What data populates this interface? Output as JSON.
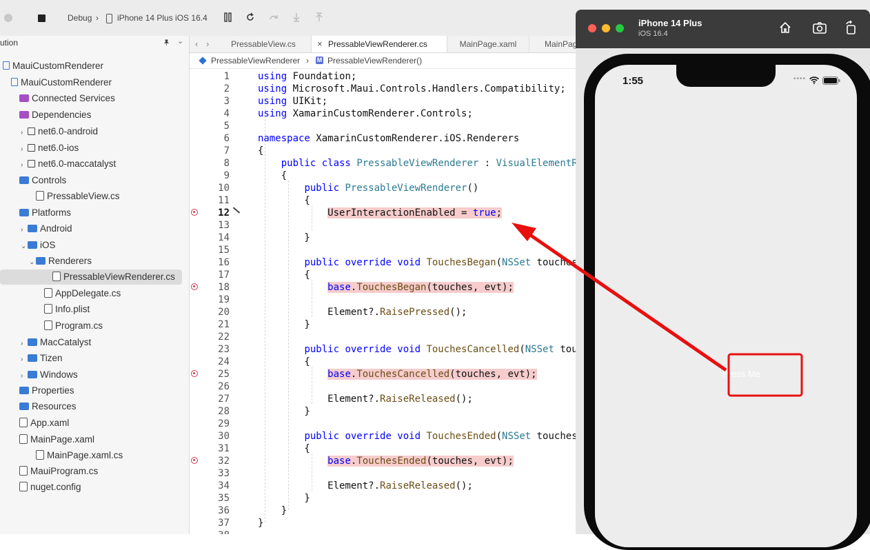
{
  "toolbar": {
    "scheme": "Debug",
    "sep": "›",
    "device": "iPhone 14 Plus iOS 16.4"
  },
  "sidebar": {
    "header": "ution",
    "items": [
      {
        "label": "MauiCustomRenderer",
        "indent": 0,
        "icon": "solution",
        "chev": ""
      },
      {
        "label": "MauiCustomRenderer",
        "indent": 1,
        "icon": "project",
        "chev": ""
      },
      {
        "label": "Connected Services",
        "indent": 2,
        "icon": "folder-p",
        "chev": ""
      },
      {
        "label": "Dependencies",
        "indent": 2,
        "icon": "folder-p",
        "chev": ""
      },
      {
        "label": "net6.0-android",
        "indent": 3,
        "icon": "framework",
        "chev": "›"
      },
      {
        "label": "net6.0-ios",
        "indent": 3,
        "icon": "framework",
        "chev": "›"
      },
      {
        "label": "net6.0-maccatalyst",
        "indent": 3,
        "icon": "framework",
        "chev": "›"
      },
      {
        "label": "Controls",
        "indent": 2,
        "icon": "folder",
        "chev": ""
      },
      {
        "label": "PressableView.cs",
        "indent": 4,
        "icon": "file",
        "chev": ""
      },
      {
        "label": "Platforms",
        "indent": 2,
        "icon": "folder",
        "chev": ""
      },
      {
        "label": "Android",
        "indent": 3,
        "icon": "folder",
        "chev": "›"
      },
      {
        "label": "iOS",
        "indent": 3,
        "icon": "folder",
        "chev": "⌄"
      },
      {
        "label": "Renderers",
        "indent": 4,
        "icon": "folder",
        "chev": "⌄"
      },
      {
        "label": "PressableViewRenderer.cs",
        "indent": 6,
        "icon": "file",
        "chev": "",
        "selected": true
      },
      {
        "label": "AppDelegate.cs",
        "indent": 5,
        "icon": "file",
        "chev": ""
      },
      {
        "label": "Info.plist",
        "indent": 5,
        "icon": "file",
        "chev": ""
      },
      {
        "label": "Program.cs",
        "indent": 5,
        "icon": "file",
        "chev": ""
      },
      {
        "label": "MacCatalyst",
        "indent": 3,
        "icon": "folder",
        "chev": "›"
      },
      {
        "label": "Tizen",
        "indent": 3,
        "icon": "folder",
        "chev": "›"
      },
      {
        "label": "Windows",
        "indent": 3,
        "icon": "folder",
        "chev": "›"
      },
      {
        "label": "Properties",
        "indent": 2,
        "icon": "folder",
        "chev": ""
      },
      {
        "label": "Resources",
        "indent": 2,
        "icon": "folder",
        "chev": ""
      },
      {
        "label": "App.xaml",
        "indent": 2,
        "icon": "file",
        "chev": ""
      },
      {
        "label": "MainPage.xaml",
        "indent": 2,
        "icon": "file",
        "chev": ""
      },
      {
        "label": "MainPage.xaml.cs",
        "indent": 4,
        "icon": "file",
        "chev": ""
      },
      {
        "label": "MauiProgram.cs",
        "indent": 2,
        "icon": "file",
        "chev": ""
      },
      {
        "label": "nuget.config",
        "indent": 2,
        "icon": "file",
        "chev": ""
      }
    ]
  },
  "tabs": [
    {
      "label": "PressableView.cs",
      "active": false
    },
    {
      "label": "PressableViewRenderer.cs",
      "active": true,
      "close": "×"
    },
    {
      "label": "MainPage.xaml",
      "active": false
    },
    {
      "label": "MainPage",
      "active": false
    }
  ],
  "breadcrumb": {
    "class_name": "PressableViewRenderer",
    "sep": "›",
    "member": "PressableViewRenderer()",
    "member_icon": "M"
  },
  "code": {
    "lines": [
      {
        "n": "1",
        "t": [
          [
            "kw",
            "using"
          ],
          [
            "",
            "&nbsp;Foundation;"
          ]
        ]
      },
      {
        "n": "2",
        "t": [
          [
            "kw",
            "using"
          ],
          [
            "",
            "&nbsp;Microsoft.Maui.Controls.Handlers.Compatibility;"
          ]
        ]
      },
      {
        "n": "3",
        "t": [
          [
            "kw",
            "using"
          ],
          [
            "",
            "&nbsp;UIKit;"
          ]
        ]
      },
      {
        "n": "4",
        "t": [
          [
            "kw",
            "using"
          ],
          [
            "",
            "&nbsp;XamarinCustomRenderer.Controls;"
          ]
        ]
      },
      {
        "n": "5",
        "t": []
      },
      {
        "n": "6",
        "t": [
          [
            "kw",
            "namespace"
          ],
          [
            "",
            "&nbsp;XamarinCustomRenderer.iOS.Renderers"
          ]
        ]
      },
      {
        "n": "7",
        "t": [
          [
            "",
            "{"
          ]
        ]
      },
      {
        "n": "8",
        "t": [
          [
            "",
            "&nbsp;&nbsp;&nbsp;&nbsp;"
          ],
          [
            "kw",
            "public class"
          ],
          [
            "",
            "&nbsp;"
          ],
          [
            "ty",
            "PressableViewRenderer"
          ],
          [
            "",
            "&nbsp;:&nbsp;"
          ],
          [
            "ty",
            "VisualElementRe"
          ]
        ]
      },
      {
        "n": "9",
        "t": [
          [
            "",
            "&nbsp;&nbsp;&nbsp;&nbsp;{"
          ]
        ]
      },
      {
        "n": "10",
        "t": [
          [
            "",
            "&nbsp;&nbsp;&nbsp;&nbsp;&nbsp;&nbsp;&nbsp;&nbsp;"
          ],
          [
            "kw",
            "public"
          ],
          [
            "",
            "&nbsp;"
          ],
          [
            "ty",
            "PressableViewRenderer"
          ],
          [
            "",
            "()"
          ]
        ]
      },
      {
        "n": "11",
        "t": [
          [
            "",
            "&nbsp;&nbsp;&nbsp;&nbsp;&nbsp;&nbsp;&nbsp;&nbsp;{"
          ]
        ]
      },
      {
        "n": "12",
        "bp": true,
        "cur": true,
        "hl": true,
        "t": [
          [
            "",
            "&nbsp;&nbsp;&nbsp;&nbsp;&nbsp;&nbsp;&nbsp;&nbsp;&nbsp;&nbsp;&nbsp;&nbsp;"
          ],
          [
            "hl",
            "UserInteractionEnabled = "
          ],
          [
            "hlkw",
            "true"
          ],
          [
            "hl",
            ";"
          ]
        ]
      },
      {
        "n": "13",
        "t": []
      },
      {
        "n": "14",
        "t": [
          [
            "",
            "&nbsp;&nbsp;&nbsp;&nbsp;&nbsp;&nbsp;&nbsp;&nbsp;}"
          ]
        ]
      },
      {
        "n": "15",
        "t": []
      },
      {
        "n": "16",
        "t": [
          [
            "",
            "&nbsp;&nbsp;&nbsp;&nbsp;&nbsp;&nbsp;&nbsp;&nbsp;"
          ],
          [
            "kw",
            "public override void"
          ],
          [
            "",
            "&nbsp;"
          ],
          [
            "mt",
            "TouchesBegan"
          ],
          [
            "",
            "("
          ],
          [
            "ty",
            "NSSet"
          ],
          [
            "",
            "&nbsp;touches,"
          ]
        ]
      },
      {
        "n": "17",
        "t": [
          [
            "",
            "&nbsp;&nbsp;&nbsp;&nbsp;&nbsp;&nbsp;&nbsp;&nbsp;{"
          ]
        ]
      },
      {
        "n": "18",
        "bp": true,
        "hlrow": true,
        "t": [
          [
            "",
            "&nbsp;&nbsp;&nbsp;&nbsp;&nbsp;&nbsp;&nbsp;&nbsp;&nbsp;&nbsp;&nbsp;&nbsp;"
          ],
          [
            "kw",
            "base"
          ],
          [
            "",
            "."
          ],
          [
            "mt",
            "TouchesBegan"
          ],
          [
            "",
            "(touches, evt);"
          ]
        ]
      },
      {
        "n": "19",
        "t": []
      },
      {
        "n": "20",
        "t": [
          [
            "",
            "&nbsp;&nbsp;&nbsp;&nbsp;&nbsp;&nbsp;&nbsp;&nbsp;&nbsp;&nbsp;&nbsp;&nbsp;Element?."
          ],
          [
            "mt",
            "RaisePressed"
          ],
          [
            "",
            "();"
          ]
        ]
      },
      {
        "n": "21",
        "t": [
          [
            "",
            "&nbsp;&nbsp;&nbsp;&nbsp;&nbsp;&nbsp;&nbsp;&nbsp;}"
          ]
        ]
      },
      {
        "n": "22",
        "t": []
      },
      {
        "n": "23",
        "t": [
          [
            "",
            "&nbsp;&nbsp;&nbsp;&nbsp;&nbsp;&nbsp;&nbsp;&nbsp;"
          ],
          [
            "kw",
            "public override void"
          ],
          [
            "",
            "&nbsp;"
          ],
          [
            "mt",
            "TouchesCancelled"
          ],
          [
            "",
            "("
          ],
          [
            "ty",
            "NSSet"
          ],
          [
            "",
            "&nbsp;touc"
          ]
        ]
      },
      {
        "n": "24",
        "t": [
          [
            "",
            "&nbsp;&nbsp;&nbsp;&nbsp;&nbsp;&nbsp;&nbsp;&nbsp;{"
          ]
        ]
      },
      {
        "n": "25",
        "bp": true,
        "hlrow": true,
        "t": [
          [
            "",
            "&nbsp;&nbsp;&nbsp;&nbsp;&nbsp;&nbsp;&nbsp;&nbsp;&nbsp;&nbsp;&nbsp;&nbsp;"
          ],
          [
            "kw",
            "base"
          ],
          [
            "",
            "."
          ],
          [
            "mt",
            "TouchesCancelled"
          ],
          [
            "",
            "(touches, evt);"
          ]
        ]
      },
      {
        "n": "26",
        "t": []
      },
      {
        "n": "27",
        "t": [
          [
            "",
            "&nbsp;&nbsp;&nbsp;&nbsp;&nbsp;&nbsp;&nbsp;&nbsp;&nbsp;&nbsp;&nbsp;&nbsp;Element?."
          ],
          [
            "mt",
            "RaiseReleased"
          ],
          [
            "",
            "();"
          ]
        ]
      },
      {
        "n": "28",
        "t": [
          [
            "",
            "&nbsp;&nbsp;&nbsp;&nbsp;&nbsp;&nbsp;&nbsp;&nbsp;}"
          ]
        ]
      },
      {
        "n": "29",
        "t": []
      },
      {
        "n": "30",
        "t": [
          [
            "",
            "&nbsp;&nbsp;&nbsp;&nbsp;&nbsp;&nbsp;&nbsp;&nbsp;"
          ],
          [
            "kw",
            "public override void"
          ],
          [
            "",
            "&nbsp;"
          ],
          [
            "mt",
            "TouchesEnded"
          ],
          [
            "",
            "("
          ],
          [
            "ty",
            "NSSet"
          ],
          [
            "",
            "&nbsp;touches,"
          ]
        ]
      },
      {
        "n": "31",
        "t": [
          [
            "",
            "&nbsp;&nbsp;&nbsp;&nbsp;&nbsp;&nbsp;&nbsp;&nbsp;{"
          ]
        ]
      },
      {
        "n": "32",
        "bp": true,
        "hlrow": true,
        "t": [
          [
            "",
            "&nbsp;&nbsp;&nbsp;&nbsp;&nbsp;&nbsp;&nbsp;&nbsp;&nbsp;&nbsp;&nbsp;&nbsp;"
          ],
          [
            "kw",
            "base"
          ],
          [
            "",
            "."
          ],
          [
            "mt",
            "TouchesEnded"
          ],
          [
            "",
            "(touches, evt);"
          ]
        ]
      },
      {
        "n": "33",
        "t": []
      },
      {
        "n": "34",
        "t": [
          [
            "",
            "&nbsp;&nbsp;&nbsp;&nbsp;&nbsp;&nbsp;&nbsp;&nbsp;&nbsp;&nbsp;&nbsp;&nbsp;Element?."
          ],
          [
            "mt",
            "RaiseReleased"
          ],
          [
            "",
            "();"
          ]
        ]
      },
      {
        "n": "35",
        "t": [
          [
            "",
            "&nbsp;&nbsp;&nbsp;&nbsp;&nbsp;&nbsp;&nbsp;&nbsp;}"
          ]
        ]
      },
      {
        "n": "36",
        "t": [
          [
            "",
            "&nbsp;&nbsp;&nbsp;&nbsp;}"
          ]
        ]
      },
      {
        "n": "37",
        "t": [
          [
            "",
            "}"
          ]
        ]
      },
      {
        "n": "38",
        "t": []
      }
    ]
  },
  "simulator": {
    "device_name": "iPhone 14 Plus",
    "os_version": "iOS 16.4",
    "time": "1:55",
    "button_label": "Press Me"
  },
  "colors": {
    "keyword": "#0000ff",
    "type": "#2b7a93",
    "method": "#6b4d14",
    "highlight": "#f6cccc",
    "breakpoint": "#d1394e",
    "annotation": "#e8100f"
  }
}
